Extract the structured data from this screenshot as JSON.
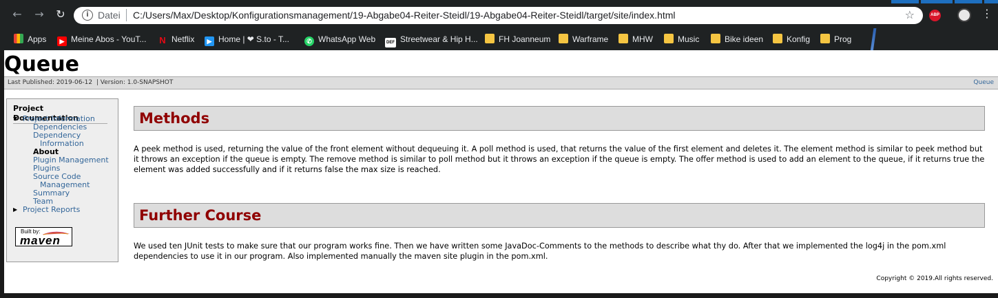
{
  "browser": {
    "omnibox_label": "Datei",
    "url": "C:/Users/Max/Desktop/Konfigurationsmanagement/19-Abgabe04-Reiter-Steidl/19-Abgabe04-Reiter-Steidl/target/site/index.html",
    "abp_label": "ABP",
    "bookmarks": [
      {
        "label": "Apps",
        "icon": "apps-grid-icon"
      },
      {
        "label": "Meine Abos - YouT...",
        "icon": "youtube-icon"
      },
      {
        "label": "Netflix",
        "icon": "netflix-icon"
      },
      {
        "label": "Home | ❤ S.to - T...",
        "icon": "sto-icon"
      },
      {
        "label": "WhatsApp Web",
        "icon": "whatsapp-icon"
      },
      {
        "label": "Streetwear & Hip H...",
        "icon": "def-icon"
      },
      {
        "label": "FH Joanneum",
        "icon": "folder-icon"
      },
      {
        "label": "Warframe",
        "icon": "folder-icon"
      },
      {
        "label": "MHW",
        "icon": "folder-icon"
      },
      {
        "label": "Music",
        "icon": "folder-icon"
      },
      {
        "label": "Bike ideen",
        "icon": "folder-icon"
      },
      {
        "label": "Konfig",
        "icon": "folder-icon"
      },
      {
        "label": "Prog",
        "icon": "folder-icon"
      }
    ]
  },
  "site": {
    "title": "Queue",
    "breadcrumb_left": "Last Published: 2019-06-12  | Version: 1.0-SNAPSHOT",
    "breadcrumb_right": "Queue",
    "nav": {
      "heading": "Project Documentation",
      "project_information": "Project Information",
      "dependencies": "Dependencies",
      "dependency": "Dependency",
      "information": "Information",
      "about": "About",
      "plugin_management": "Plugin Management",
      "plugins": "Plugins",
      "source_code": "Source Code",
      "management": "Management",
      "summary": "Summary",
      "team": "Team",
      "project_reports": "Project Reports"
    },
    "badge": {
      "built_by": "Built by:",
      "maven": "maven"
    },
    "sections": [
      {
        "heading": "Methods",
        "text": "A peek method is used, returning the value of the front element without dequeuing it. A poll method is used, that returns the value of the first element and deletes it. The element method is similar to peek method but it throws an exception if the queue is empty. The remove method is similar to poll method but it throws an exception if the queue is empty. The offer method is used to add an element to the queue, if it returns true the element was added successfully and if it returns false the max size is reached."
      },
      {
        "heading": "Further Course",
        "text": "We used ten JUnit tests to make sure that our program works fine. Then we have written some JavaDoc-Comments to the methods to describe what thy do. After that we implemented the log4j in the pom.xml dependencies to use it in our program. Also implemented manually the maven site plugin in the pom.xml."
      }
    ],
    "footer": "Copyright © 2019.All rights reserved."
  },
  "colors": {
    "chrome_bg": "#1f2223",
    "section_heading": "#900000",
    "link": "#336699",
    "header_bg": "#dddddd"
  }
}
